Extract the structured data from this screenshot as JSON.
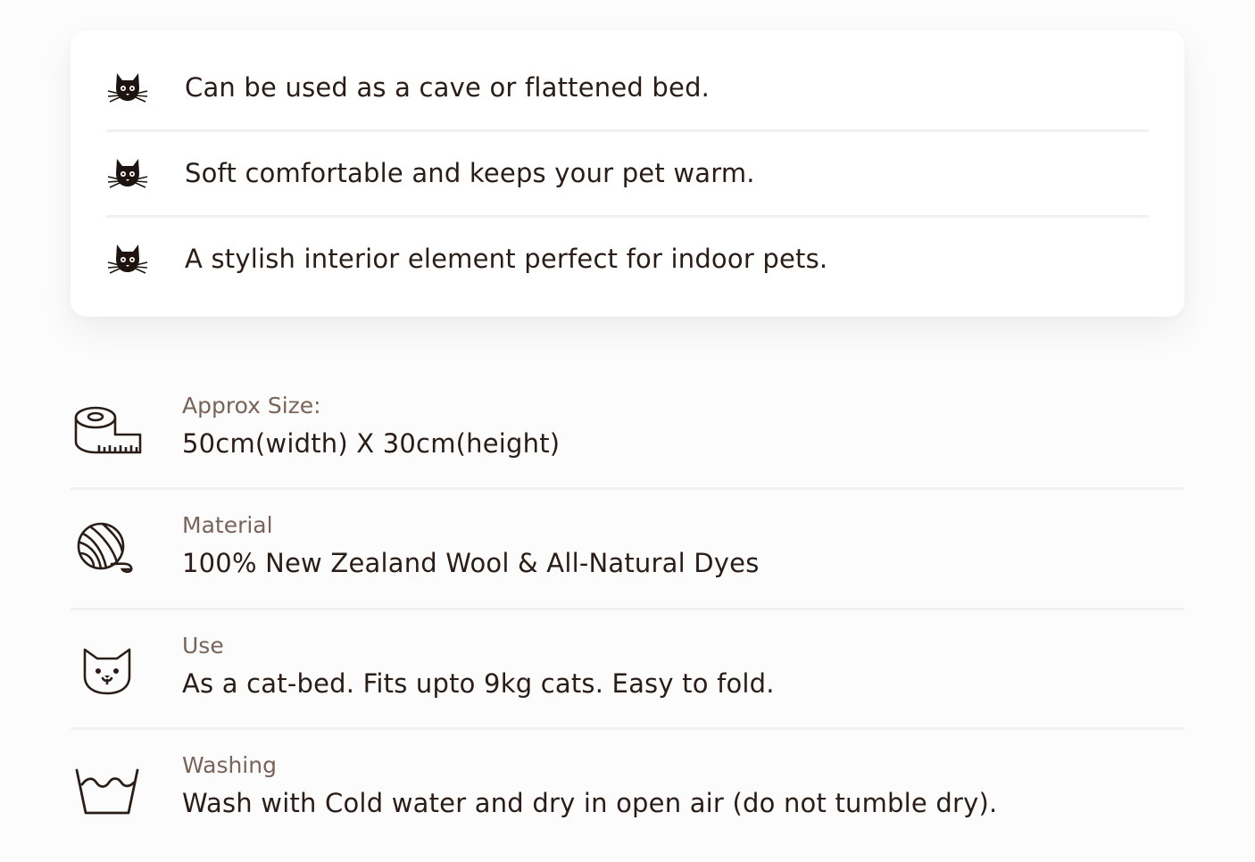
{
  "features": [
    {
      "icon": "cat-head-icon",
      "text": "Can be used as a cave or flattened bed."
    },
    {
      "icon": "cat-head-icon",
      "text": "Soft comfortable and keeps your pet warm."
    },
    {
      "icon": "cat-head-icon",
      "text": "A stylish interior element perfect for indoor pets."
    }
  ],
  "specs": [
    {
      "icon": "measuring-tape-icon",
      "label": "Approx Size:",
      "value": "50cm(width) X 30cm(height)"
    },
    {
      "icon": "yarn-ball-icon",
      "label": "Material",
      "value": "100% New Zealand Wool & All-Natural Dyes"
    },
    {
      "icon": "cat-face-icon",
      "label": "Use",
      "value": "As a cat-bed. Fits upto 9kg cats. Easy to fold."
    },
    {
      "icon": "wash-basin-icon",
      "label": "Washing",
      "value": "Wash with Cold water and dry in open air (do not tumble dry)."
    }
  ],
  "colors": {
    "text": "#2a1d17",
    "label": "#7a6359",
    "divider": "#f1f1f1",
    "card": "#ffffff"
  }
}
